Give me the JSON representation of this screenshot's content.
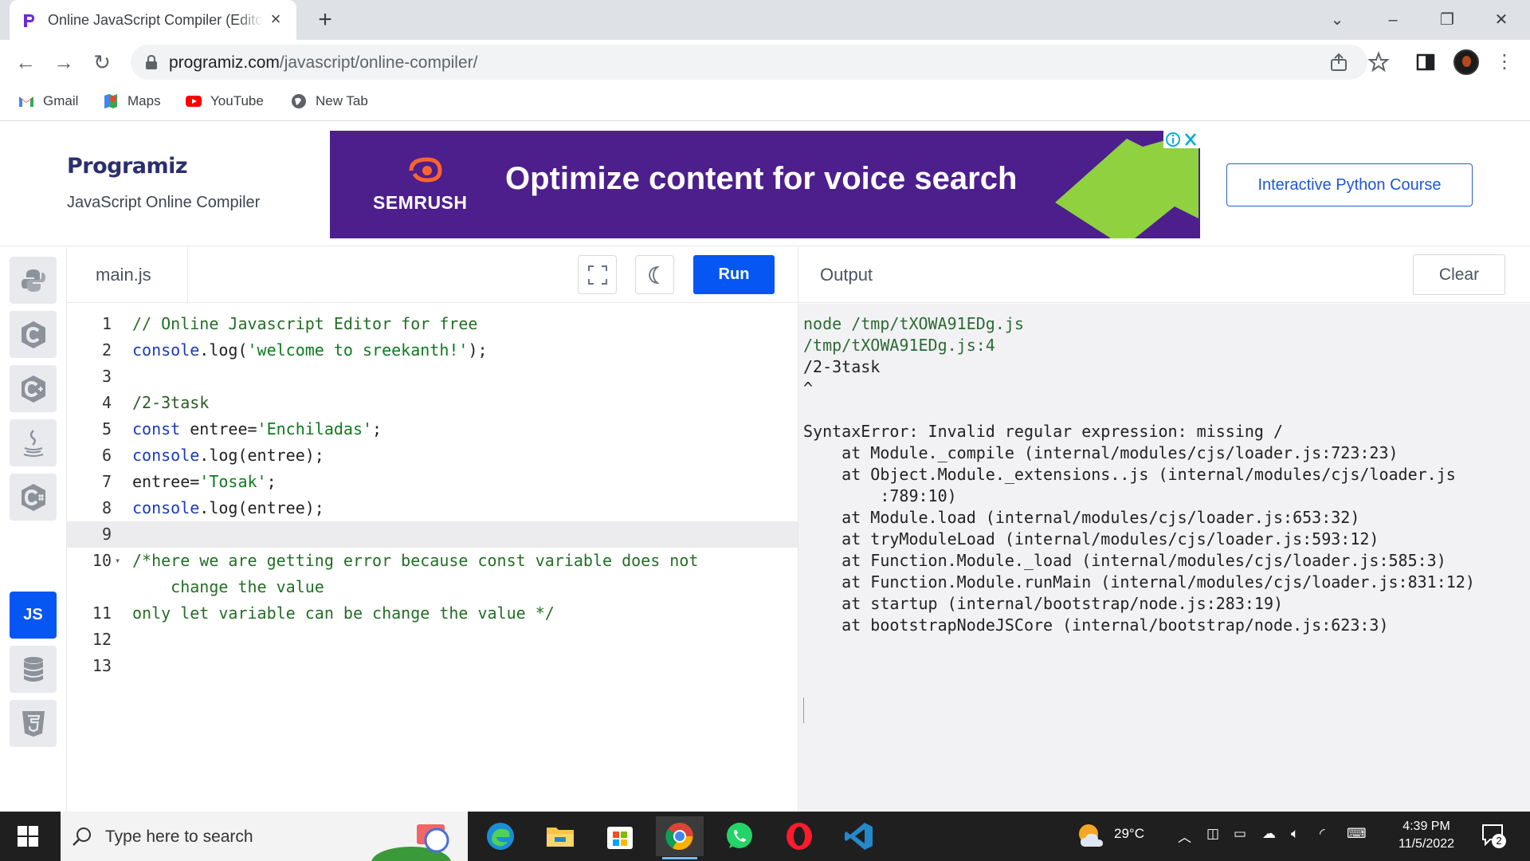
{
  "browser": {
    "tab_title": "Online JavaScript Compiler (Editor)",
    "url_host": "programiz.com",
    "url_path": "/javascript/online-compiler/",
    "bookmarks": [
      {
        "label": "Gmail",
        "icon": "gmail-icon"
      },
      {
        "label": "Maps",
        "icon": "maps-icon"
      },
      {
        "label": "YouTube",
        "icon": "youtube-icon"
      },
      {
        "label": "New Tab",
        "icon": "globe-icon"
      }
    ]
  },
  "header": {
    "logo": "Programiz",
    "subtitle": "JavaScript Online Compiler",
    "ad_brand": "SEMRUSH",
    "ad_headline": "Optimize content for voice search",
    "course_button": "Interactive Python Course"
  },
  "languages": [
    "python",
    "c",
    "cpp",
    "java",
    "csharp",
    "JS",
    "sql",
    "html5"
  ],
  "editor": {
    "file_name": "main.js",
    "run_label": "Run",
    "lines": [
      {
        "n": "1",
        "segments": [
          {
            "t": "// Online Javascript Editor for free",
            "c": "comment"
          }
        ]
      },
      {
        "n": "2",
        "segments": [
          {
            "t": "console",
            "c": "kw"
          },
          {
            "t": ".log(",
            "c": ""
          },
          {
            "t": "'welcome to sreekanth!'",
            "c": "str"
          },
          {
            "t": ");",
            "c": ""
          }
        ]
      },
      {
        "n": "3",
        "segments": []
      },
      {
        "n": "4",
        "segments": [
          {
            "t": "/2-3task",
            "c": "regex"
          }
        ]
      },
      {
        "n": "5",
        "segments": [
          {
            "t": "const",
            "c": "kw"
          },
          {
            "t": " entree=",
            "c": ""
          },
          {
            "t": "'Enchiladas'",
            "c": "str"
          },
          {
            "t": ";",
            "c": ""
          }
        ]
      },
      {
        "n": "6",
        "segments": [
          {
            "t": "console",
            "c": "kw"
          },
          {
            "t": ".log(entree);",
            "c": ""
          }
        ]
      },
      {
        "n": "7",
        "segments": [
          {
            "t": "entree=",
            "c": ""
          },
          {
            "t": "'Tosak'",
            "c": "str"
          },
          {
            "t": ";",
            "c": ""
          }
        ]
      },
      {
        "n": "8",
        "segments": [
          {
            "t": "console",
            "c": "kw"
          },
          {
            "t": ".log(entree);",
            "c": ""
          }
        ]
      },
      {
        "n": "9",
        "segments": [],
        "highlight": true
      },
      {
        "n": "10",
        "fold": true,
        "segments": [
          {
            "t": "/*here we are getting error because const variable does not",
            "c": "comment"
          }
        ]
      },
      {
        "n": "",
        "segments": [
          {
            "t": "    change the value",
            "c": "comment"
          }
        ]
      },
      {
        "n": "11",
        "segments": [
          {
            "t": "only let variable can be change the value */",
            "c": "comment"
          }
        ]
      },
      {
        "n": "12",
        "segments": []
      },
      {
        "n": "13",
        "segments": []
      }
    ]
  },
  "output": {
    "title": "Output",
    "clear_label": "Clear",
    "lines": [
      {
        "t": "node /tmp/tXOWA91EDg.js",
        "cmd": true
      },
      {
        "t": "/tmp/tXOWA91EDg.js:4",
        "cmd": true
      },
      {
        "t": "/2-3task"
      },
      {
        "t": "^"
      },
      {
        "t": ""
      },
      {
        "t": "SyntaxError: Invalid regular expression: missing /"
      },
      {
        "t": "    at Module._compile (internal/modules/cjs/loader.js:723:23)"
      },
      {
        "t": "    at Object.Module._extensions..js (internal/modules/cjs/loader.js"
      },
      {
        "t": "        :789:10)"
      },
      {
        "t": "    at Module.load (internal/modules/cjs/loader.js:653:32)"
      },
      {
        "t": "    at tryModuleLoad (internal/modules/cjs/loader.js:593:12)"
      },
      {
        "t": "    at Function.Module._load (internal/modules/cjs/loader.js:585:3)"
      },
      {
        "t": "    at Function.Module.runMain (internal/modules/cjs/loader.js:831:12)"
      },
      {
        "t": "    at startup (internal/bootstrap/node.js:283:19)"
      },
      {
        "t": "    at bootstrapNodeJSCore (internal/bootstrap/node.js:623:3)"
      }
    ]
  },
  "taskbar": {
    "search_placeholder": "Type here to search",
    "weather": "29°C",
    "time": "4:39 PM",
    "date": "11/5/2022",
    "notifications": "2",
    "apps": [
      "edge-icon",
      "file-explorer-icon",
      "store-icon",
      "chrome-icon",
      "whatsapp-icon",
      "opera-icon",
      "vscode-icon"
    ]
  },
  "colors": {
    "accent": "#0556f3",
    "ad_bg": "#4c1f8c",
    "comment": "#236e25",
    "keyword": "#1a3ab8"
  }
}
